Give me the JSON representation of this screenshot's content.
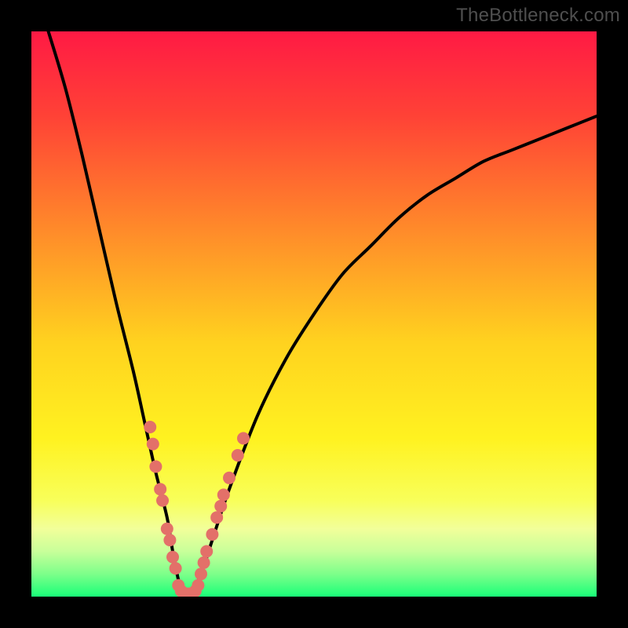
{
  "watermark": "TheBottleneck.com",
  "colors": {
    "frame": "#000000",
    "curve": "#000000",
    "dots": "#e37069",
    "gradient_stops": [
      {
        "offset": 0.0,
        "color": "#ff1a44"
      },
      {
        "offset": 0.15,
        "color": "#ff4236"
      },
      {
        "offset": 0.35,
        "color": "#ff8a2a"
      },
      {
        "offset": 0.55,
        "color": "#ffd21f"
      },
      {
        "offset": 0.72,
        "color": "#fff220"
      },
      {
        "offset": 0.83,
        "color": "#f8ff5a"
      },
      {
        "offset": 0.88,
        "color": "#f2ff9a"
      },
      {
        "offset": 0.92,
        "color": "#c8ff9a"
      },
      {
        "offset": 0.96,
        "color": "#7dff8a"
      },
      {
        "offset": 1.0,
        "color": "#19ff78"
      }
    ]
  },
  "chart_data": {
    "type": "line",
    "title": "",
    "xlabel": "",
    "ylabel": "",
    "xlim": [
      0,
      100
    ],
    "ylim": [
      0,
      100
    ],
    "series": [
      {
        "name": "bottleneck-curve",
        "x": [
          3,
          6,
          9,
          12,
          15,
          18,
          20,
          22,
          24,
          25,
          26,
          27,
          28,
          30,
          32,
          35,
          40,
          45,
          50,
          55,
          60,
          65,
          70,
          75,
          80,
          85,
          90,
          95,
          100
        ],
        "y": [
          100,
          90,
          78,
          65,
          52,
          40,
          31,
          22,
          14,
          8,
          3,
          0,
          0,
          4,
          10,
          19,
          32,
          42,
          50,
          57,
          62,
          67,
          71,
          74,
          77,
          79,
          81,
          83,
          85
        ]
      }
    ],
    "scatter": [
      {
        "name": "sample-points",
        "points": [
          {
            "x": 21,
            "y": 30
          },
          {
            "x": 21.5,
            "y": 27
          },
          {
            "x": 22,
            "y": 23
          },
          {
            "x": 22.8,
            "y": 19
          },
          {
            "x": 23.2,
            "y": 17
          },
          {
            "x": 24,
            "y": 12
          },
          {
            "x": 24.5,
            "y": 10
          },
          {
            "x": 25,
            "y": 7
          },
          {
            "x": 25.5,
            "y": 5
          },
          {
            "x": 26,
            "y": 2
          },
          {
            "x": 26.5,
            "y": 1
          },
          {
            "x": 27,
            "y": 0.5
          },
          {
            "x": 27.5,
            "y": 0.5
          },
          {
            "x": 28,
            "y": 0.5
          },
          {
            "x": 28.5,
            "y": 0.5
          },
          {
            "x": 29,
            "y": 1
          },
          {
            "x": 29.5,
            "y": 2
          },
          {
            "x": 30,
            "y": 4
          },
          {
            "x": 30.5,
            "y": 6
          },
          {
            "x": 31,
            "y": 8
          },
          {
            "x": 32,
            "y": 11
          },
          {
            "x": 32.8,
            "y": 14
          },
          {
            "x": 33.5,
            "y": 16
          },
          {
            "x": 34,
            "y": 18
          },
          {
            "x": 35,
            "y": 21
          },
          {
            "x": 36.5,
            "y": 25
          },
          {
            "x": 37.5,
            "y": 28
          }
        ]
      }
    ]
  }
}
